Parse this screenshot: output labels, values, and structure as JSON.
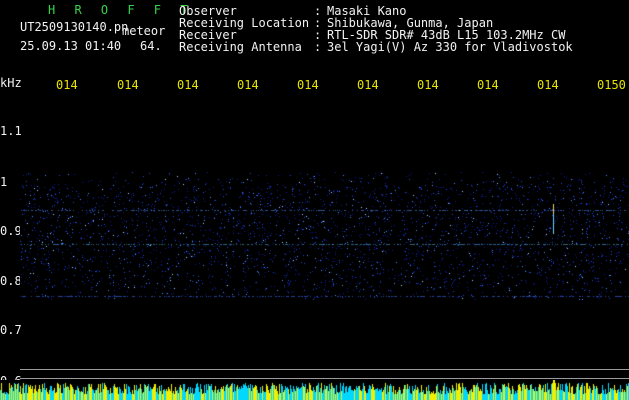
{
  "header": {
    "app_title": "H R O F F T",
    "file_name": "UT2509130140.pn",
    "file_tag": "meteor",
    "timestamp": "25.09.13 01:40",
    "frame_value": "64.",
    "fields": [
      {
        "label": "Observer",
        "sep": ":",
        "value": "Masaki Kano"
      },
      {
        "label": "Receiving Location",
        "sep": ":",
        "value": "Shibukawa, Gunma, Japan"
      },
      {
        "label": "Receiver",
        "sep": ":",
        "value": "RTL-SDR SDR# 43dB L15 103.2MHz CW"
      },
      {
        "label": "Receiving Antenna",
        "sep": ":",
        "value": "3el Yagi(V) Az 330 for Vladivostok"
      }
    ]
  },
  "axis": {
    "unit": "kHz",
    "y_ticks": [
      "1.1",
      "1",
      "0.9",
      "0.8",
      "0.7",
      "0.6"
    ],
    "y_range": [
      0.6,
      1.15
    ]
  },
  "time_labels": [
    "014",
    "014",
    "014",
    "014",
    "014",
    "014",
    "014",
    "014",
    "014",
    "0150"
  ],
  "colors": {
    "background": "#000000",
    "text": "#f2f2f2",
    "time": "#e6e600",
    "title": "#37d34a",
    "noise_low": "#0a1a8a",
    "noise_high": "#6fa8ff",
    "bar_cyan": "#00d8ff",
    "bar_yellow": "#f0f000"
  }
}
